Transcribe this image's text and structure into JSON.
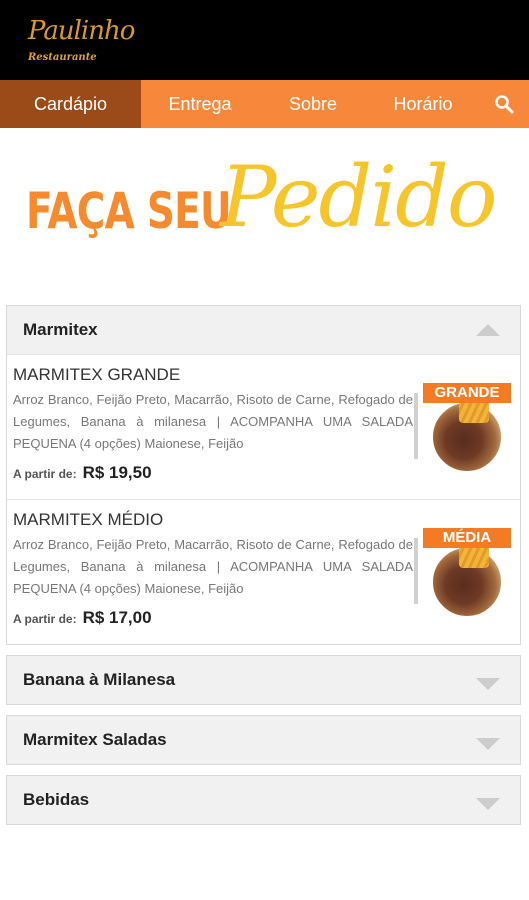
{
  "brand": {
    "logo_script": "Paulinho",
    "logo_sub": "Restaurante"
  },
  "nav": {
    "items": [
      {
        "label": "Cardápio",
        "active": true
      },
      {
        "label": "Entrega"
      },
      {
        "label": "Sobre"
      },
      {
        "label": "Horário"
      }
    ],
    "search_icon": "search-icon"
  },
  "hero": {
    "line1": "FAÇA SEU",
    "line2": "Pedido"
  },
  "colors": {
    "nav_bg": "#f7873a",
    "nav_active_bg": "#9a4b17",
    "hero_orange": "#f58a2e",
    "hero_yellow": "#f5c52b",
    "header_bg": "#000000"
  },
  "sections": [
    {
      "title": "Marmitex",
      "expanded": true,
      "items": [
        {
          "name": "MARMITEX GRANDE",
          "description": "Arroz Branco, Feijão Preto, Macarrão, Risoto de Carne, Refogado de Legumes, Banana à milanesa | ACOMPANHA UMA SALADA PEQUENA (4 opções) Maionese, Feijão",
          "price_label": "A partir de:",
          "price": "R$ 19,50",
          "badge": "GRANDE"
        },
        {
          "name": "MARMITEX MÉDIO",
          "description": "Arroz Branco, Feijão Preto, Macarrão, Risoto de Carne, Refogado de Legumes, Banana à milanesa | ACOMPANHA UMA SALADA PEQUENA (4 opções) Maionese, Feijão",
          "price_label": "A partir de:",
          "price": "R$ 17,00",
          "badge": "MÉDIA"
        }
      ]
    },
    {
      "title": "Banana à Milanesa",
      "expanded": false
    },
    {
      "title": "Marmitex Saladas",
      "expanded": false
    },
    {
      "title": "Bebidas",
      "expanded": false
    }
  ]
}
